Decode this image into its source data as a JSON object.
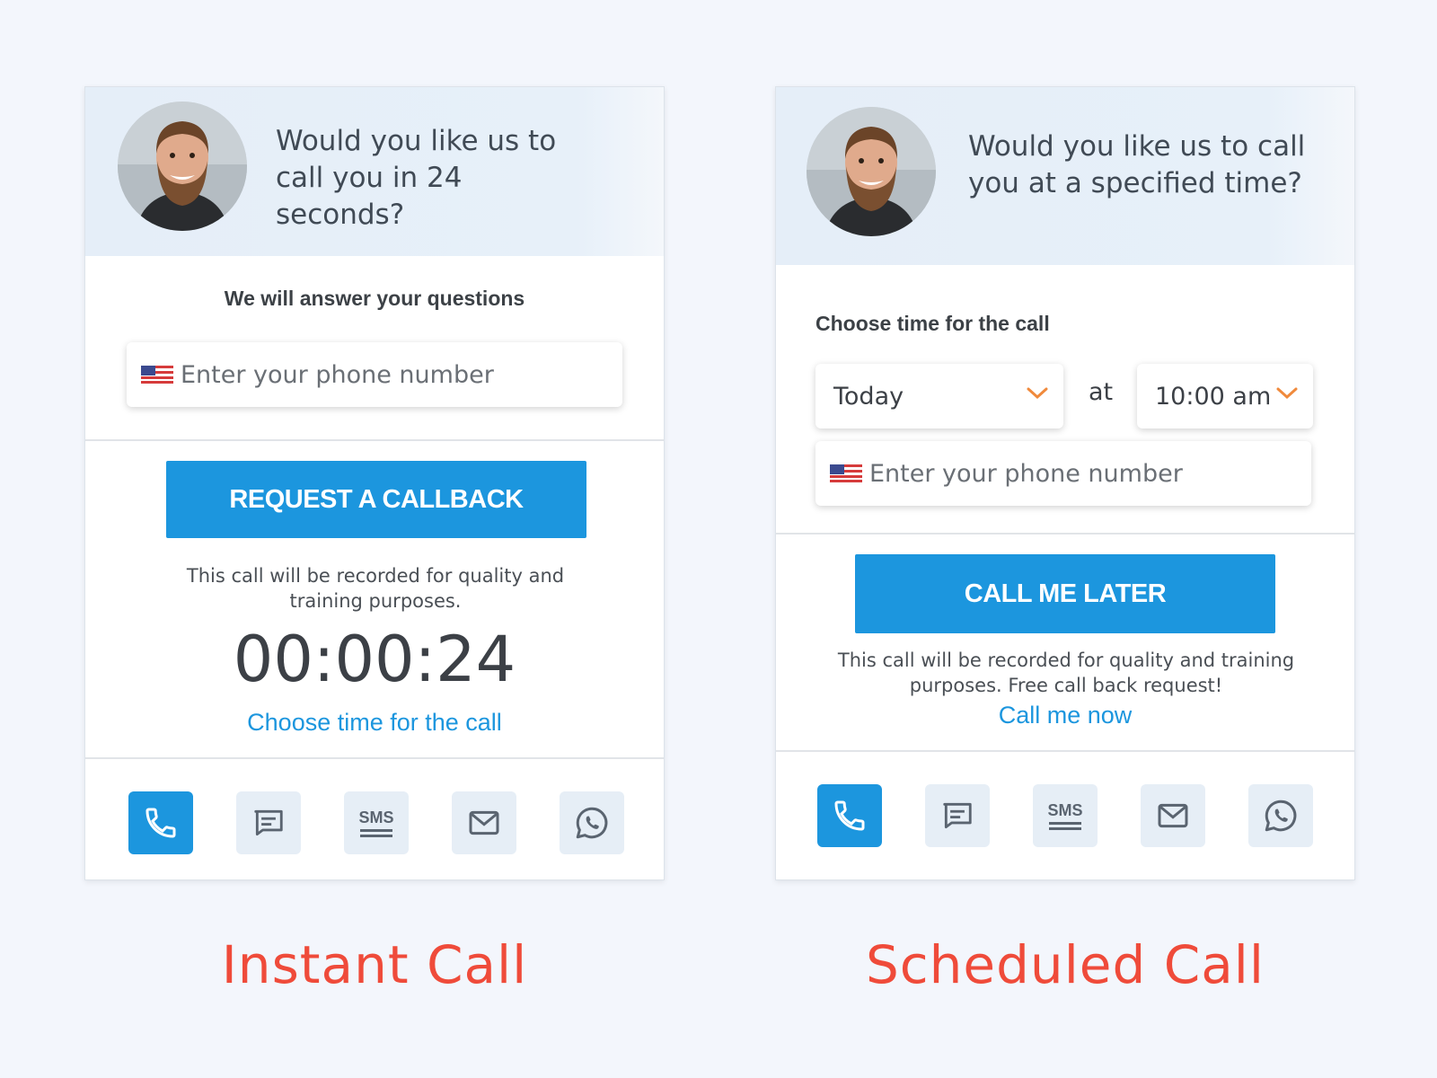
{
  "instant": {
    "header_question": "Would you like us to call you in 24 seconds?",
    "subtitle": "We will answer your questions",
    "phone_placeholder": "Enter your phone number",
    "cta_label": "REQUEST A CALLBACK",
    "note": "This call will be recorded for quality and training purposes.",
    "timer": "00:00:24",
    "link_label": "Choose time for the call",
    "caption": "Instant Call"
  },
  "scheduled": {
    "header_question": "Would you like us to call you at a specified time?",
    "subtitle": "Choose time for the call",
    "day_value": "Today",
    "at_label": "at",
    "time_value": "10:00 am",
    "phone_placeholder": "Enter your phone number",
    "cta_label": "CALL ME LATER",
    "note": "This call will be recorded for quality and training purposes. Free call back request!",
    "link_label": "Call me now",
    "caption": "Scheduled Call"
  },
  "channels": {
    "items": [
      {
        "icon": "phone-icon",
        "active": true
      },
      {
        "icon": "chat-icon",
        "active": false
      },
      {
        "icon": "sms-icon",
        "label": "SMS",
        "active": false
      },
      {
        "icon": "mail-icon",
        "active": false
      },
      {
        "icon": "whatsapp-icon",
        "active": false
      }
    ]
  },
  "colors": {
    "accent": "#1c96de",
    "caption": "#ef4b3a",
    "header_bg": "#e5eef8",
    "page_bg": "#f3f6fc",
    "chevron": "#f08a3c",
    "channel_bg": "#e6eef6"
  }
}
